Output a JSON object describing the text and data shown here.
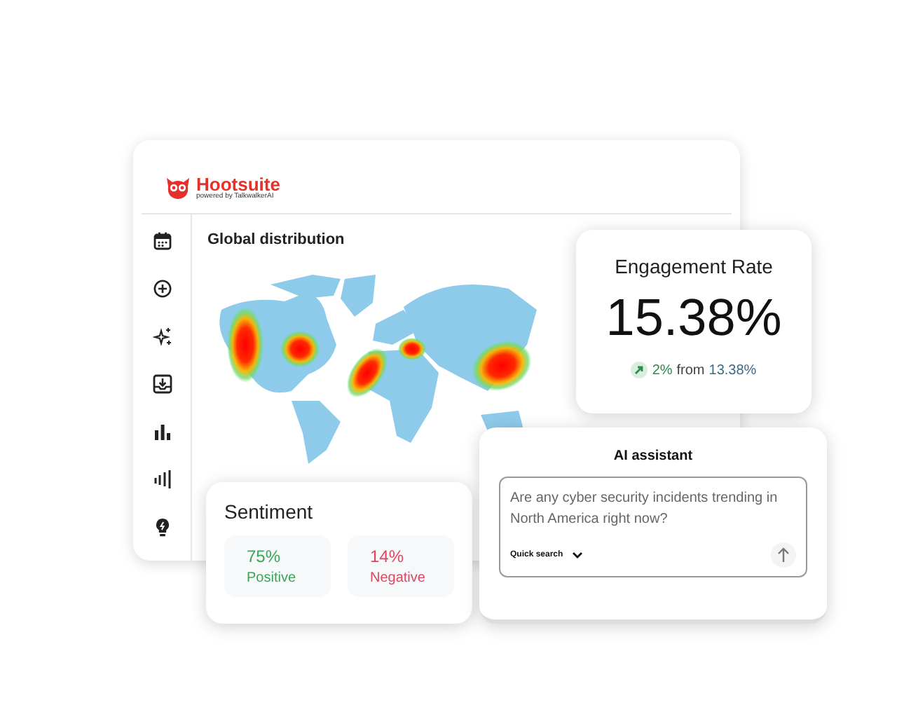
{
  "logo": {
    "brand": "Hootsuite",
    "tagline": "powered by TalkwalkerAI"
  },
  "map_panel": {
    "title": "Global distribution"
  },
  "engagement": {
    "title": "Engagement Rate",
    "value": "15.38%",
    "change": "2%",
    "from_label": "from",
    "previous": "13.38%"
  },
  "ai_assistant": {
    "title": "AI assistant",
    "prompt": "Are any cyber security incidents trending in North America right now?",
    "mode": "Quick search"
  },
  "sentiment": {
    "title": "Sentiment",
    "items": [
      {
        "value": "75%",
        "label": "Positive",
        "color": "#3aa757"
      },
      {
        "value": "14%",
        "label": "Negative",
        "color": "#e0455f"
      }
    ]
  }
}
